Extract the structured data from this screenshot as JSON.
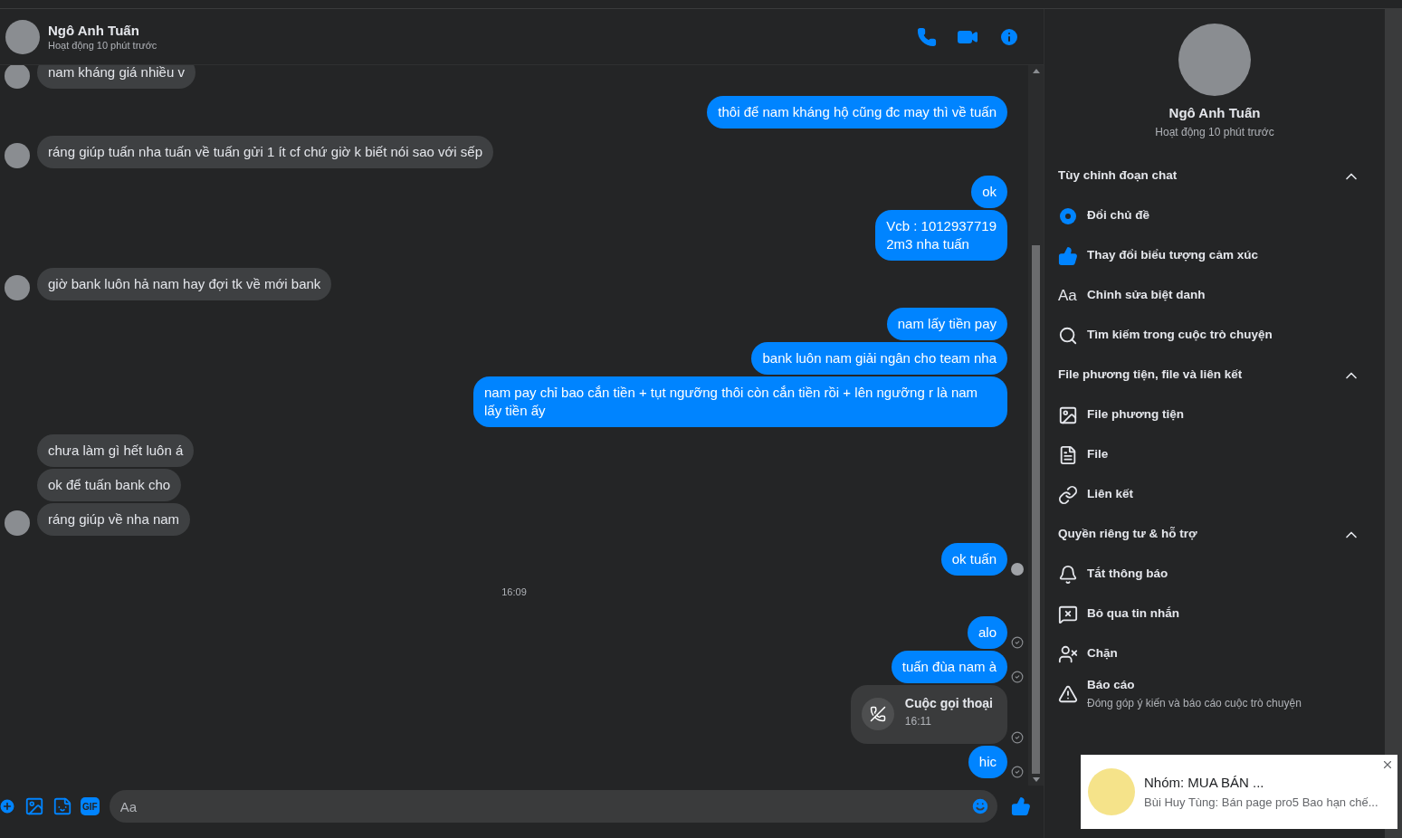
{
  "header": {
    "name": "Ngô Anh Tuấn",
    "status": "Hoạt động 10 phút trước"
  },
  "messages": [
    {
      "kind": "incoming",
      "text": "nam kháng giá nhiều v",
      "avatar": true
    },
    {
      "kind": "outgoing",
      "text": "thôi để nam kháng hộ cũng đc may thì về tuấn",
      "seen": false,
      "sent": false
    },
    {
      "kind": "incoming",
      "text": "ráng giúp tuấn nha tuấn về tuấn gửi 1 ít cf chứ giờ k biết nói sao với sếp",
      "avatar": true
    },
    {
      "kind": "outgoing",
      "text": "ok",
      "seen": false,
      "sent": false
    },
    {
      "kind": "outgoing",
      "text": "Vcb : 1012937719\n2m3 nha tuấn",
      "seen": false,
      "sent": false
    },
    {
      "kind": "incoming",
      "text": "giờ bank luôn hả nam hay đợi tk về mới bank",
      "avatar": true
    },
    {
      "kind": "outgoing",
      "text": "nam lấy tiền pay",
      "seen": false,
      "sent": false
    },
    {
      "kind": "outgoing",
      "text": "bank luôn nam giải ngân cho team nha",
      "seen": false,
      "sent": false
    },
    {
      "kind": "outgoing",
      "text": "nam pay chỉ bao cắn tiền + tụt ngưỡng thôi còn cắn tiền rồi + lên ngưỡng r là nam lấy tiền ấy",
      "seen": false,
      "sent": false
    },
    {
      "kind": "incoming",
      "text": "chưa làm gì hết luôn á",
      "avatar": false
    },
    {
      "kind": "incoming",
      "text": "ok để tuấn bank cho",
      "avatar": false
    },
    {
      "kind": "incoming",
      "text": "ráng giúp về nha nam",
      "avatar": true
    },
    {
      "kind": "outgoing",
      "text": "ok tuấn",
      "seen": true,
      "sent": false
    },
    {
      "kind": "timestamp",
      "text": "16:09"
    },
    {
      "kind": "outgoing",
      "text": "alo",
      "seen": false,
      "sent": true
    },
    {
      "kind": "outgoing",
      "text": "tuấn đùa nam à",
      "seen": false,
      "sent": true
    },
    {
      "kind": "call",
      "text": "Cuộc gọi thoại",
      "time": "16:11",
      "seen": false,
      "sent": true
    },
    {
      "kind": "outgoing",
      "text": "hic",
      "seen": false,
      "sent": true
    }
  ],
  "composer": {
    "gif_label": "GIF",
    "placeholder": "Aa"
  },
  "profile": {
    "name": "Ngô Anh Tuấn",
    "status": "Hoạt động 10 phút trước"
  },
  "sections": [
    {
      "title": "Tùy chỉnh đoạn chat",
      "expanded": true,
      "items": [
        {
          "label": "Đổi chủ đề"
        },
        {
          "label": "Thay đổi biểu tượng cảm xúc"
        },
        {
          "label": "Chỉnh sửa biệt danh",
          "icon_text": "Aa"
        },
        {
          "label": "Tìm kiếm trong cuộc trò chuyện"
        }
      ]
    },
    {
      "title": "File phương tiện, file và liên kết",
      "expanded": true,
      "items": [
        {
          "label": "File phương tiện"
        },
        {
          "label": "File"
        },
        {
          "label": "Liên kết"
        }
      ]
    },
    {
      "title": "Quyền riêng tư & hỗ trợ",
      "expanded": true,
      "items": [
        {
          "label": "Tắt thông báo"
        },
        {
          "label": "Bỏ qua tin nhắn"
        },
        {
          "label": "Chặn"
        },
        {
          "label": "Báo cáo",
          "sub": "Đóng góp ý kiến và báo cáo cuộc trò chuyện"
        }
      ]
    }
  ],
  "notification": {
    "title": "Nhóm: MUA BÁN ...",
    "body": "Bùi Huy Tùng: Bán page pro5 Bao hạn chế..."
  }
}
